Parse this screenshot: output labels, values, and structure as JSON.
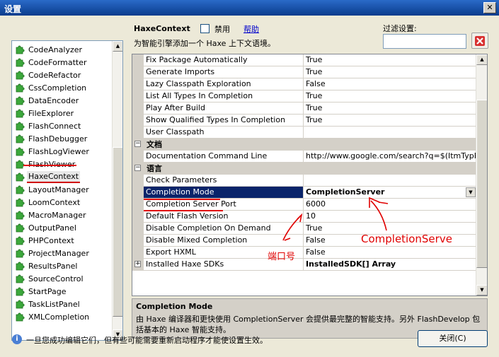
{
  "window": {
    "title": "设置",
    "close_glyph": "✕"
  },
  "plugins": [
    {
      "label": "CodeAnalyzer"
    },
    {
      "label": "CodeFormatter"
    },
    {
      "label": "CodeRefactor"
    },
    {
      "label": "CssCompletion"
    },
    {
      "label": "DataEncoder"
    },
    {
      "label": "FileExplorer"
    },
    {
      "label": "FlashConnect"
    },
    {
      "label": "FlashDebugger"
    },
    {
      "label": "FlashLogViewer"
    },
    {
      "label": "FlashViewer"
    },
    {
      "label": "HaxeContext",
      "selected": true
    },
    {
      "label": "LayoutManager"
    },
    {
      "label": "LoomContext"
    },
    {
      "label": "MacroManager"
    },
    {
      "label": "OutputPanel"
    },
    {
      "label": "PHPContext"
    },
    {
      "label": "ProjectManager"
    },
    {
      "label": "ResultsPanel"
    },
    {
      "label": "SourceControl"
    },
    {
      "label": "StartPage"
    },
    {
      "label": "TaskListPanel"
    },
    {
      "label": "XMLCompletion"
    }
  ],
  "header": {
    "plugin_name": "HaxeContext",
    "disable_label": "禁用",
    "help_link": "帮助",
    "description": "为智能引擎添加一个 Haxe 上下文语境。",
    "filter_label": "过滤设置:",
    "filter_value": ""
  },
  "grid": {
    "rows": [
      {
        "kind": "prop",
        "name": "Fix Package Automatically",
        "value": "True"
      },
      {
        "kind": "prop",
        "name": "Generate Imports",
        "value": "True"
      },
      {
        "kind": "prop",
        "name": "Lazy Classpath Exploration",
        "value": "False"
      },
      {
        "kind": "prop",
        "name": "List All Types In Completion",
        "value": "True"
      },
      {
        "kind": "prop",
        "name": "Play After Build",
        "value": "True"
      },
      {
        "kind": "prop",
        "name": "Show Qualified Types In Completion",
        "value": "True"
      },
      {
        "kind": "prop",
        "name": "User Classpath",
        "value": ""
      },
      {
        "kind": "category",
        "name": "文档",
        "expander": "−"
      },
      {
        "kind": "prop",
        "name": "Documentation Command Line",
        "value": "http://www.google.com/search?q=$(ItmTypPkg)-"
      },
      {
        "kind": "category",
        "name": "语言",
        "expander": "−"
      },
      {
        "kind": "prop",
        "name": "Check Parameters",
        "value": ""
      },
      {
        "kind": "prop",
        "name": "Completion Mode",
        "value": "CompletionServer",
        "selected": true,
        "bold": true,
        "dropdown": true
      },
      {
        "kind": "prop",
        "name": "Completion Server Port",
        "value": "6000"
      },
      {
        "kind": "prop",
        "name": "Default Flash Version",
        "value": "10"
      },
      {
        "kind": "prop",
        "name": "Disable Completion On Demand",
        "value": "True"
      },
      {
        "kind": "prop",
        "name": "Disable Mixed Completion",
        "value": "False"
      },
      {
        "kind": "prop",
        "name": "Export HXML",
        "value": "False"
      },
      {
        "kind": "prop",
        "name": "Installed Haxe SDKs",
        "value": "InstalledSDK[] Array",
        "bold": true,
        "expander": "+"
      }
    ]
  },
  "description_panel": {
    "title": "Completion Mode",
    "text": "由 Haxe 编译器和更快使用 CompletionServer 会提供最完整的智能支持。另外 FlashDevelop 包括基本的 Haxe 智能支持。"
  },
  "footer": {
    "info_glyph": "i",
    "message": "一旦您成功编辑它们，但有些可能需要重新启动程序才能使设置生效。",
    "close_button": "关闭(C)"
  },
  "annotations": {
    "port_label": "端口号",
    "mode_label": "CompletionServe",
    "color": "#e00000"
  },
  "colors": {
    "selection": "#0a246a",
    "accent_red": "#e00000",
    "link": "#0000cc"
  }
}
